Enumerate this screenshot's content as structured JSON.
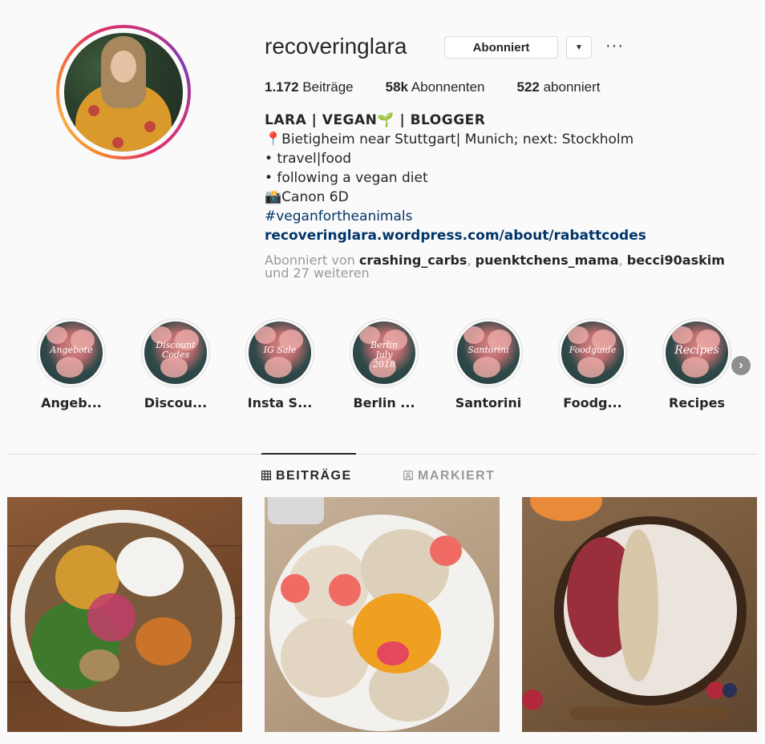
{
  "profile": {
    "username": "recoveringlara",
    "follow_button": "Abonniert",
    "dropdown_icon": "caret-down-icon",
    "more_label": "···"
  },
  "stats": {
    "posts_count": "1.172",
    "posts_label": "Beiträge",
    "followers_count": "58k",
    "followers_label": "Abonnenten",
    "following_count": "522",
    "following_label": "abonniert"
  },
  "bio": {
    "name": "LARA | VEGAN🌱 | BLOGGER",
    "location": "📍Bietigheim near Stuttgart| Munich; next: Stockholm",
    "line1": "• travel|food",
    "line2": "• following a vegan diet",
    "camera": "📸Canon 6D",
    "hashtag": "#veganfortheanimals",
    "link": "recoveringlara.wordpress.com/about/rabattcodes"
  },
  "followed_by": {
    "prefix": "Abonniert von ",
    "user1": "crashing_carbs",
    "sep1": ", ",
    "user2": "puenktchens_mama",
    "sep2": ", ",
    "user3": "becci90askim",
    "suffix": "und 27 weiteren"
  },
  "highlights": [
    {
      "cover_text": "Angebote",
      "label": "Angeb..."
    },
    {
      "cover_text": "Discount Codes",
      "label": "Discou..."
    },
    {
      "cover_text": "IG Sale",
      "label": "Insta S..."
    },
    {
      "cover_text": "Berlin July 2018",
      "label": "Berlin ..."
    },
    {
      "cover_text": "Santorini",
      "label": "Santorini"
    },
    {
      "cover_text": "Foodguide",
      "label": "Foodg..."
    },
    {
      "cover_text": "Recipes",
      "label": "Recipes"
    }
  ],
  "highlights_next_icon": "chevron-right-icon",
  "tabs": {
    "posts_label": "BEITRÄGE",
    "posts_icon": "grid-icon",
    "tagged_label": "MARKIERT",
    "tagged_icon": "tagged-person-icon"
  },
  "colors": {
    "text": "#262626",
    "muted": "#999999",
    "link": "#003569",
    "border": "#dbdbdb"
  }
}
